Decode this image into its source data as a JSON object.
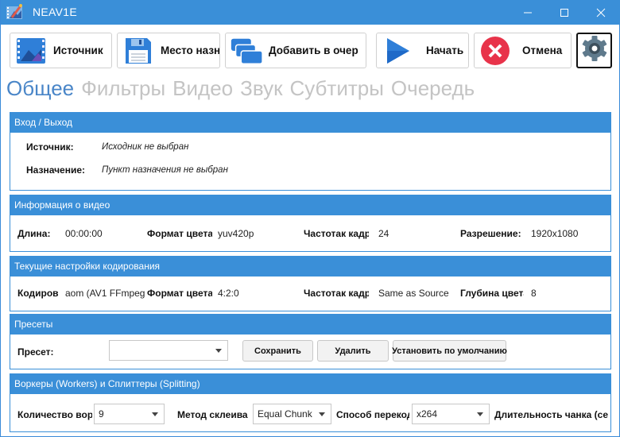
{
  "window": {
    "title": "NEAV1E"
  },
  "toolbar": {
    "source_label": "Источник",
    "destination_label": "Место назн",
    "add_queue_label": "Добавить в очер",
    "start_label": "Начать",
    "cancel_label": "Отмена"
  },
  "tabs": [
    {
      "label": "Общее",
      "active": true
    },
    {
      "label": "Фильтры"
    },
    {
      "label": "Видео"
    },
    {
      "label": "Звук"
    },
    {
      "label": "Субтитры"
    },
    {
      "label": "Очередь"
    }
  ],
  "io": {
    "header": "Вход / Выход",
    "source_label": "Источник:",
    "source_value": "Исходник не выбран",
    "dest_label": "Назначение:",
    "dest_value": "Пункт назначения не выбран"
  },
  "video_info": {
    "header": "Информация о видео",
    "length_label": "Длина:",
    "length_value": "00:00:00",
    "color_format_label": "Формат цвета",
    "color_format_value": "yuv420p",
    "framerate_label": "Частотак кадр",
    "framerate_value": "24",
    "resolution_label": "Разрешение:",
    "resolution_value": "1920x1080"
  },
  "encoding": {
    "header": "Текущие настройки кодирования",
    "encoder_label": "Кодиров",
    "encoder_value": "aom (AV1 FFmpeg",
    "color_format_label": "Формат цвета",
    "color_format_value": "4:2:0",
    "framerate_label": "Частотак кадр",
    "framerate_value": "Same as Source",
    "bitdepth_label": "Глубина цвета",
    "bitdepth_value": "8"
  },
  "presets": {
    "header": "Пресеты",
    "preset_label": "Пресет:",
    "preset_value": "",
    "save_label": "Сохранить",
    "delete_label": "Удалить",
    "default_label": "Установить по умолчанию"
  },
  "workers": {
    "header": "Воркеры (Workers) и Сплиттеры (Splitting)",
    "count_label": "Количество вор",
    "count_value": "9",
    "concat_label": "Метод склеива",
    "concat_value": "Equal Chunk",
    "reencode_label": "Способ перекод",
    "reencode_value": "x264",
    "chunk_length_label": "Длительность чанка (се"
  },
  "colors": {
    "accent": "#3a8fd8",
    "active_tab": "#4a86c8",
    "inactive_tab": "#c4c4c4",
    "cancel_red": "#e8334a"
  }
}
